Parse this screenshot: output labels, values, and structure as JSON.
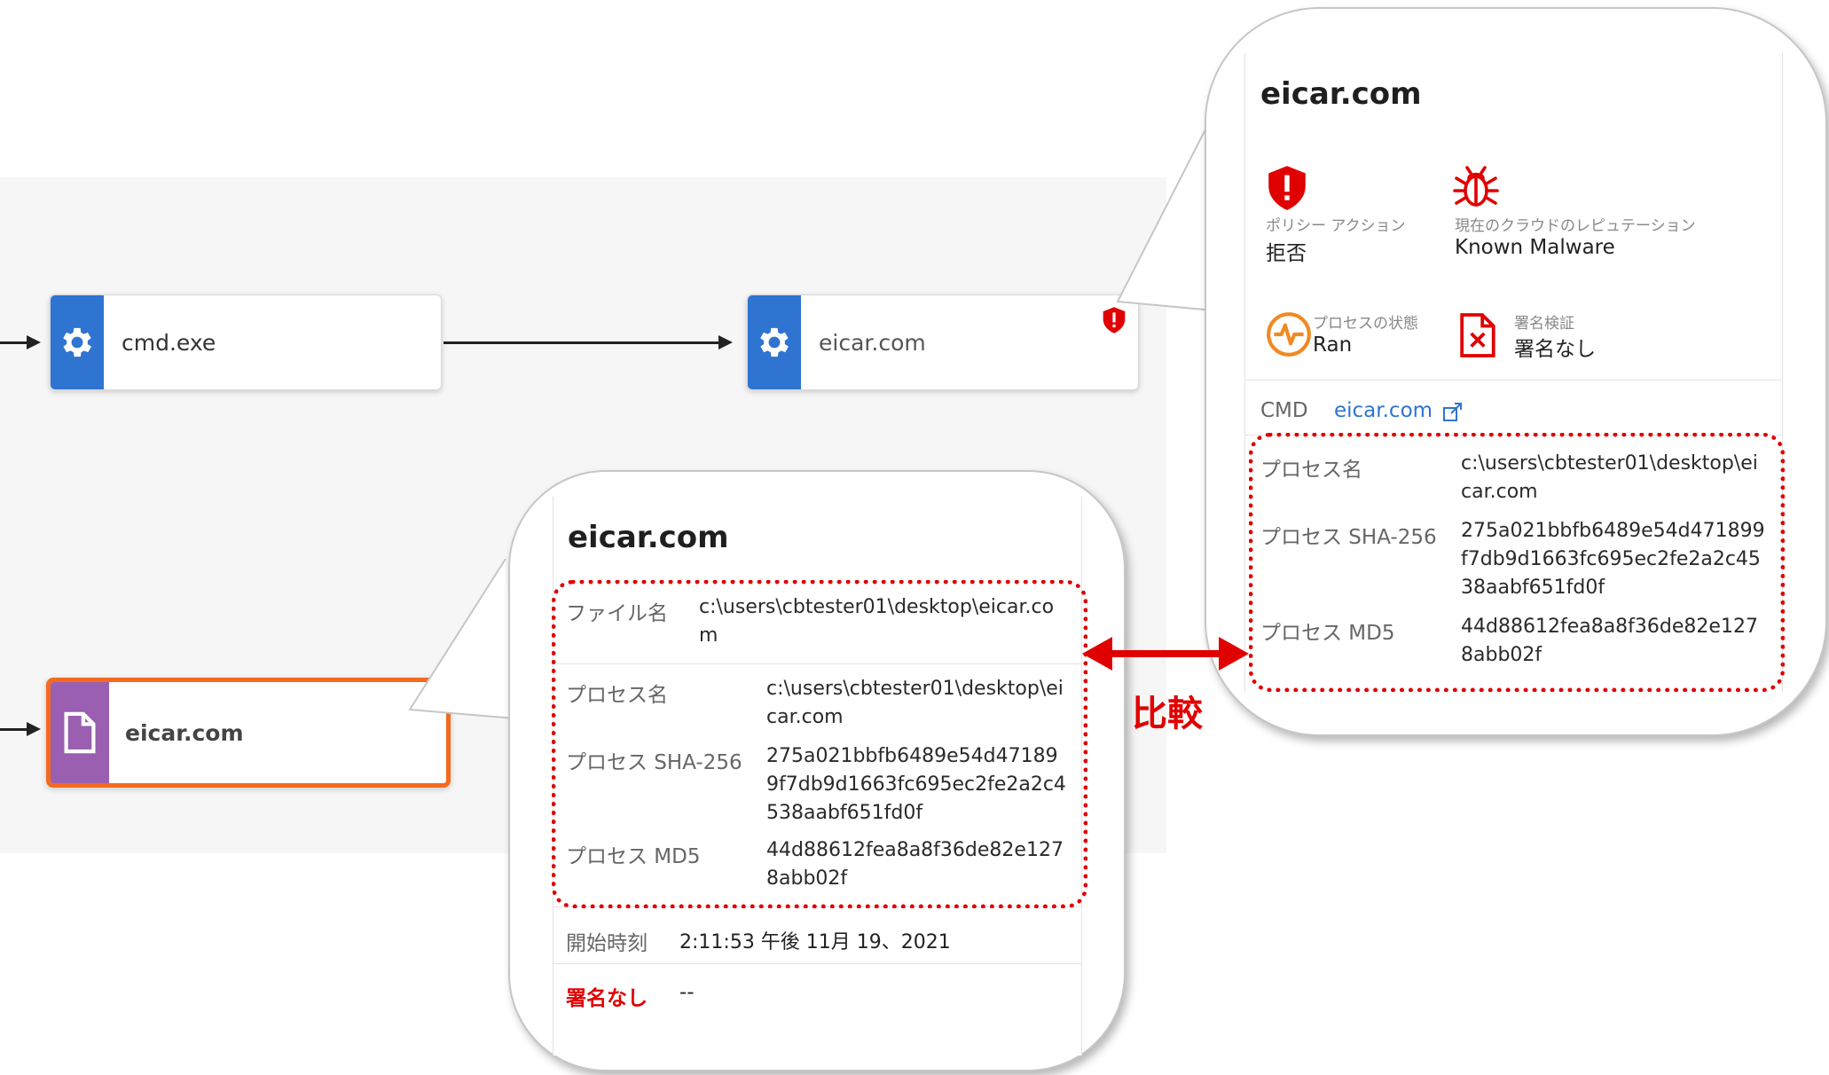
{
  "graph": {
    "node_cmd": {
      "label": "cmd.exe",
      "icon": "gear-icon"
    },
    "node_eicar_process": {
      "label": "eicar.com",
      "icon": "gear-icon",
      "badge": "shield-alert-icon"
    },
    "node_eicar_file": {
      "label": "eicar.com",
      "icon": "file-icon"
    }
  },
  "process_panel": {
    "title": "eicar.com",
    "policy_action_label": "ポリシー アクション",
    "policy_action_value": "拒否",
    "reputation_label": "現在のクラウドのレピュテーション",
    "reputation_value": "Known Malware",
    "process_state_label": "プロセスの状態",
    "process_state_value": "Ran",
    "signature_label": "署名検証",
    "signature_value": "署名なし",
    "cmd_label": "CMD",
    "cmd_value": "eicar.com",
    "process_name_label": "プロセス名",
    "process_name_value": "c:\\users\\cbtester01\\desktop\\eicar.com",
    "sha256_label": "プロセス SHA-256",
    "sha256_value": "275a021bbfb6489e54d471899f7db9d1663fc695ec2fe2a2c4538aabf651fd0f",
    "md5_label": "プロセス MD5",
    "md5_value": "44d88612fea8a8f36de82e1278abb02f"
  },
  "file_panel": {
    "title": "eicar.com",
    "file_name_label": "ファイル名",
    "file_name_value": "c:\\users\\cbtester01\\desktop\\eicar.com",
    "process_name_label": "プロセス名",
    "process_name_value": "c:\\users\\cbtester01\\desktop\\eicar.com",
    "sha256_label": "プロセス SHA-256",
    "sha256_value": "275a021bbfb6489e54d471899f7db9d1663fc695ec2fe2a2c4538aabf651fd0f",
    "md5_label": "プロセス MD5",
    "md5_value": "44d88612fea8a8f36de82e1278abb02f",
    "start_time_label": "開始時刻",
    "start_time_value": "2:11:53 午後 11月 19、2021",
    "signature_label": "署名なし",
    "signature_value": "--"
  },
  "annotation": {
    "compare_label": "比較"
  },
  "colors": {
    "blue": "#2f74d0",
    "purple": "#9a5fb0",
    "orange": "#f46a1f",
    "red": "#e00000",
    "link": "#2f74d0"
  }
}
